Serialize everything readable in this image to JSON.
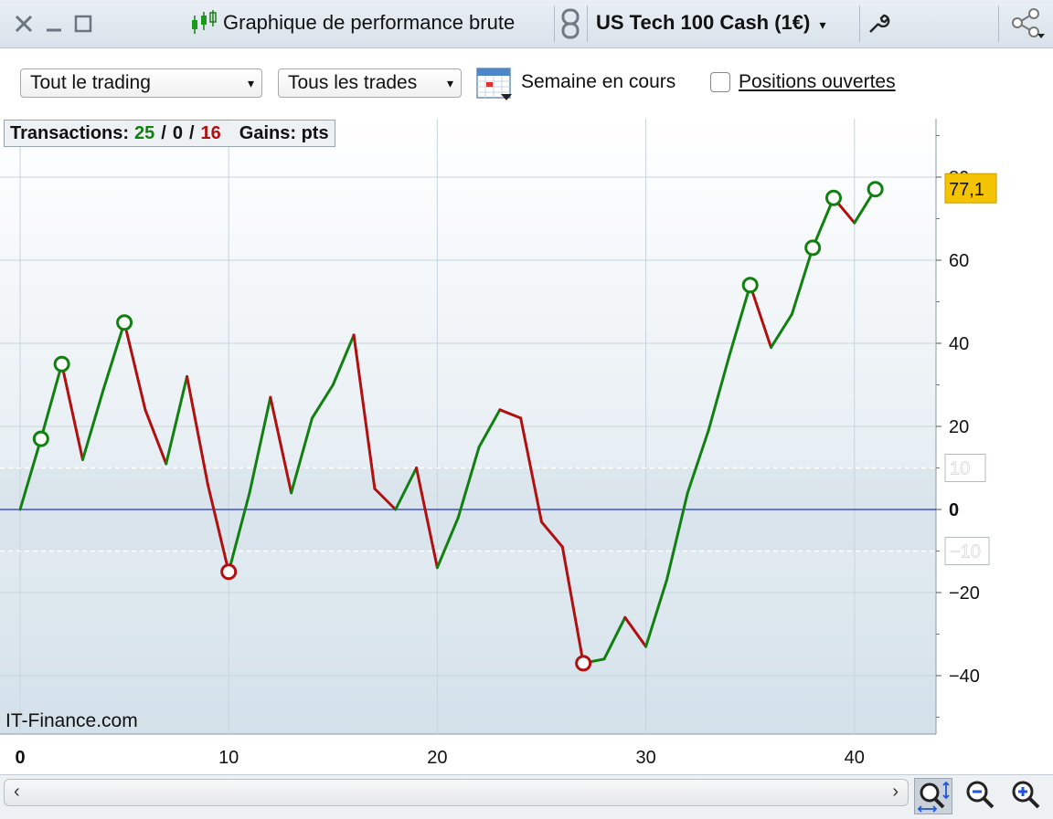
{
  "window": {
    "title": "Graphique de performance brute",
    "instrument": "US Tech 100 Cash (1€)"
  },
  "toolbar": {
    "filter_select": "Tout le trading",
    "trades_select": "Tous les trades",
    "period_label": "Semaine en cours",
    "open_positions_label": "Positions ouvertes",
    "open_positions_checked": false
  },
  "stats": {
    "transactions_label": "Transactions:",
    "wins": "25",
    "sep1": "/",
    "even": "0",
    "sep2": "/",
    "losses": "16",
    "gains_label": "Gains: pts"
  },
  "watermark": "IT-Finance.com",
  "colors": {
    "up": "#118011",
    "down": "#b01010",
    "zero_line": "#2233cc",
    "last_value_bg": "#f5c400"
  },
  "chart_data": {
    "type": "line",
    "x": [
      0,
      1,
      2,
      3,
      4,
      5,
      6,
      7,
      8,
      9,
      10,
      11,
      12,
      13,
      14,
      15,
      16,
      17,
      18,
      19,
      20,
      21,
      22,
      23,
      24,
      25,
      26,
      27,
      28,
      29,
      30,
      31,
      32,
      33,
      34,
      35,
      36,
      37,
      38,
      39,
      40,
      41
    ],
    "y": [
      0,
      17,
      35,
      12,
      29,
      45,
      24,
      11,
      32,
      6,
      -15,
      4,
      27,
      4,
      22,
      30,
      42,
      5,
      0,
      10,
      -14,
      -2,
      15,
      24,
      22,
      -3,
      -9,
      -37,
      -36,
      -26,
      -33,
      -17,
      4,
      19,
      37,
      54,
      39,
      47,
      63,
      75,
      69,
      77.1
    ],
    "markers": [
      1,
      2,
      5,
      10,
      27,
      35,
      38,
      39,
      41
    ],
    "xlim": [
      0,
      44
    ],
    "ylim": [
      -54,
      95
    ],
    "xticks": [
      "0",
      "10",
      "20",
      "30",
      "40"
    ],
    "xtick_values": [
      0,
      10,
      20,
      30,
      40
    ],
    "yticks": [
      "80",
      "60",
      "40",
      "20",
      "0",
      "−20",
      "−40"
    ],
    "ytick_values": [
      80,
      60,
      40,
      20,
      0,
      -20,
      -40
    ],
    "band_labels": [
      "10",
      "−10"
    ],
    "band_values": [
      10,
      -10
    ],
    "last_value_label": "77,1",
    "grid": true
  },
  "bottom": {
    "scroll_left": "‹",
    "scroll_right": "›"
  },
  "icons": {
    "close": "close-icon",
    "minimize": "minimize-icon",
    "maximize": "maximize-icon",
    "candles": "candlestick-icon",
    "link": "link-icon",
    "wrench": "wrench-icon",
    "share": "share-icon",
    "calendar": "calendar-icon",
    "zoom_fit": "zoom-fit-icon",
    "zoom_out": "zoom-out-icon",
    "zoom_in": "zoom-in-icon"
  }
}
